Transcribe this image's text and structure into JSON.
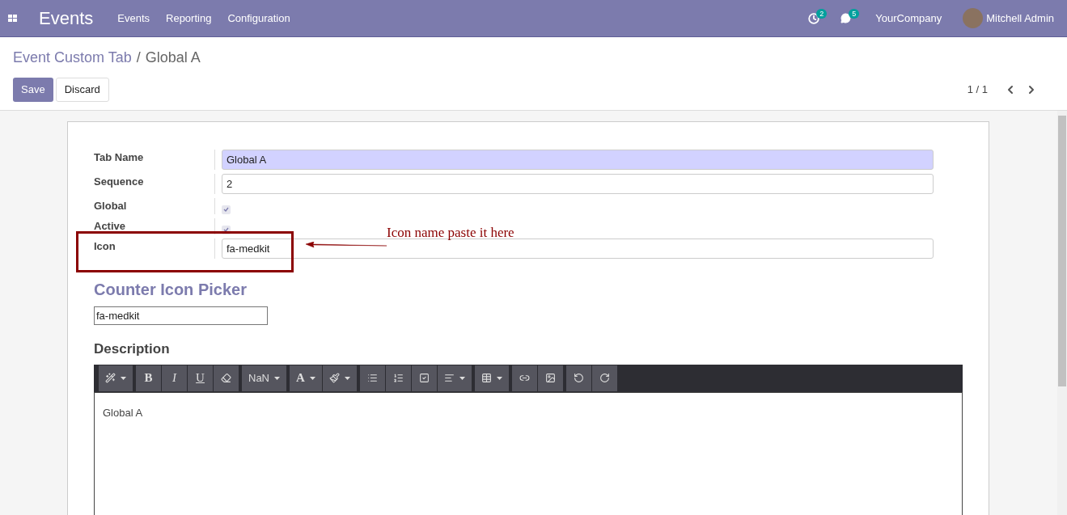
{
  "navbar": {
    "app_title": "Events",
    "menu": [
      "Events",
      "Reporting",
      "Configuration"
    ],
    "activity_count": "2",
    "message_count": "5",
    "company": "YourCompany",
    "user": "Mitchell Admin"
  },
  "breadcrumb": {
    "parent": "Event Custom Tab",
    "separator": "/",
    "current": "Global A"
  },
  "buttons": [
    {
      "label": "Save",
      "kind": "primary"
    },
    {
      "label": "Discard",
      "kind": "secondary"
    }
  ],
  "pager": {
    "value": "1 / 1"
  },
  "form": {
    "fields": [
      {
        "label": "Tab Name",
        "kind": "text",
        "value": "Global A",
        "required": true
      },
      {
        "label": "Sequence",
        "kind": "text",
        "value": "2",
        "required": false
      },
      {
        "label": "Global",
        "kind": "checkbox",
        "checked": true
      },
      {
        "label": "Active",
        "kind": "checkbox",
        "checked": true
      },
      {
        "label": "Icon",
        "kind": "text",
        "value": "fa-medkit",
        "required": false
      }
    ],
    "annotation": "Icon name paste it here",
    "picker_title": "Counter Icon Picker",
    "picker_value": "fa-medkit",
    "description_title": "Description",
    "toolbar": [
      [
        {
          "kind": "icon",
          "dropdown": true
        }
      ],
      [
        {
          "kind": "bold",
          "label": "B",
          "dropdown": false
        },
        {
          "kind": "italic",
          "label": "I",
          "dropdown": false
        },
        {
          "kind": "underline",
          "label": "U",
          "dropdown": false
        },
        {
          "kind": "icon",
          "dropdown": false
        }
      ],
      [
        {
          "kind": "text",
          "label": "NaN",
          "dropdown": true
        }
      ],
      [
        {
          "kind": "bold",
          "label": "A",
          "dropdown": true
        },
        {
          "kind": "icon",
          "dropdown": true
        }
      ],
      [
        {
          "kind": "icon",
          "dropdown": false
        },
        {
          "kind": "icon",
          "dropdown": false
        },
        {
          "kind": "icon",
          "dropdown": false
        },
        {
          "kind": "icon",
          "dropdown": true
        }
      ],
      [
        {
          "kind": "icon",
          "dropdown": true
        }
      ],
      [
        {
          "kind": "icon",
          "dropdown": false
        },
        {
          "kind": "icon",
          "dropdown": false
        }
      ],
      [
        {
          "kind": "icon",
          "dropdown": false
        },
        {
          "kind": "icon",
          "dropdown": false
        }
      ]
    ],
    "editor_text": "Global A"
  }
}
